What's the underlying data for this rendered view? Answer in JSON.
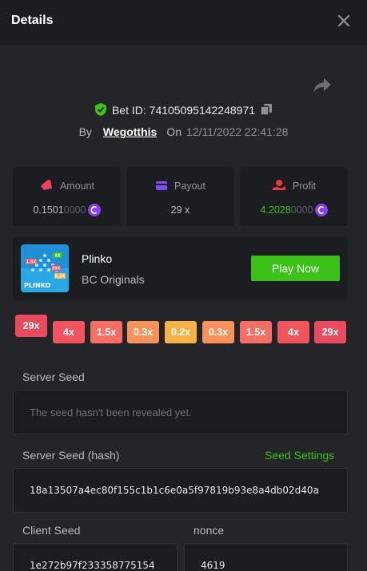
{
  "header": {
    "title": "Details"
  },
  "bet": {
    "id_label": "Bet ID: 74105095142248971",
    "by_label": "By",
    "username": "Wegotthis",
    "on_label": "On",
    "date": "12/11/2022 22:41:28"
  },
  "stats": {
    "amount": {
      "label": "Amount",
      "value_main": "0.1501",
      "value_dim": "0000"
    },
    "payout": {
      "label": "Payout",
      "value": "29 x"
    },
    "profit": {
      "label": "Profit",
      "value_main": "4.2028",
      "value_dim": "0000"
    }
  },
  "game": {
    "name": "Plinko",
    "provider": "BC Originals",
    "play_label": "Play Now",
    "thumb_title": "PLINKO",
    "thumb_tags": [
      "1.5X",
      "4X",
      "0.3X",
      "29X"
    ]
  },
  "multipliers": [
    {
      "label": "29x",
      "color": "#ea4a5e",
      "hit": true
    },
    {
      "label": "4x",
      "color": "#f0555e"
    },
    {
      "label": "1.5x",
      "color": "#f46e63"
    },
    {
      "label": "0.3x",
      "color": "#f7925a"
    },
    {
      "label": "0.2x",
      "color": "#f9b247"
    },
    {
      "label": "0.3x",
      "color": "#f7925a"
    },
    {
      "label": "1.5x",
      "color": "#f46e63"
    },
    {
      "label": "4x",
      "color": "#f0555e"
    },
    {
      "label": "29x",
      "color": "#ea4a5e"
    }
  ],
  "seeds": {
    "server_seed_label": "Server Seed",
    "server_seed_placeholder": "The seed hasn't been revealed yet.",
    "server_hash_label": "Server Seed (hash)",
    "seed_settings_label": "Seed Settings",
    "server_hash_value": "18a13507a4ec80f155c1b1c6e0a5f97819b93e8a4db02d40a",
    "client_seed_label": "Client Seed",
    "client_seed_value": "1e272b97f233358775154",
    "nonce_label": "nonce",
    "nonce_value": "4619"
  },
  "colors": {
    "accent_green": "#3bc117",
    "coin_purple": "#8a3ef7",
    "amount_icon": "#ee3f65",
    "payout_icon": "#7b4ff2",
    "profit_icon": "#ea3b3b"
  },
  "icons": [
    "close-icon",
    "share-icon",
    "verified-shield-icon",
    "copy-icon",
    "amount-icon",
    "payout-wallet-icon",
    "profit-icon",
    "coin-icon"
  ]
}
